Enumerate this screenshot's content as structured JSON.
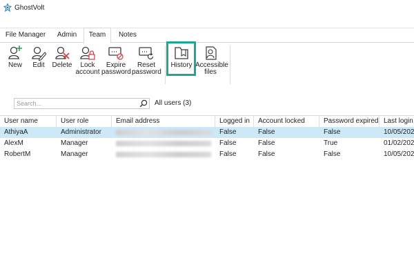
{
  "app": {
    "title": "GhostVolt"
  },
  "tabs": [
    {
      "label": "File Manager",
      "active": false
    },
    {
      "label": "Admin",
      "active": false
    },
    {
      "label": "Team",
      "active": true
    },
    {
      "label": "Notes",
      "active": false
    }
  ],
  "ribbon": {
    "new": "New",
    "edit": "Edit",
    "delete": "Delete",
    "lock_account_1": "Lock",
    "lock_account_2": "account",
    "expire_password_1": "Expire",
    "expire_password_2": "password",
    "reset_password_1": "Reset",
    "reset_password_2": "password",
    "history": "History",
    "accessible_files_1": "Accessible",
    "accessible_files_2": "files"
  },
  "colors": {
    "highlight": "#1aa894",
    "selected_row": "#cde8f7",
    "delete_icon": "#d9363e",
    "new_icon": "#2e9e4f"
  },
  "search": {
    "placeholder": "Search...",
    "value": ""
  },
  "filter_label": "All users (3)",
  "table": {
    "headers": [
      "User name",
      "User role",
      "Email address",
      "Logged in",
      "Account locked",
      "Password expired",
      "Last login"
    ],
    "rows": [
      {
        "user": "AthiyaA",
        "role": "Administrator",
        "logged_in": "False",
        "locked": "False",
        "expired": "False",
        "last_login": "10/05/202",
        "selected": true
      },
      {
        "user": "AlexM",
        "role": "Manager",
        "logged_in": "False",
        "locked": "False",
        "expired": "True",
        "last_login": "01/02/202",
        "selected": false
      },
      {
        "user": "RobertM",
        "role": "Manager",
        "logged_in": "False",
        "locked": "False",
        "expired": "False",
        "last_login": "10/05/202",
        "selected": false
      }
    ]
  }
}
